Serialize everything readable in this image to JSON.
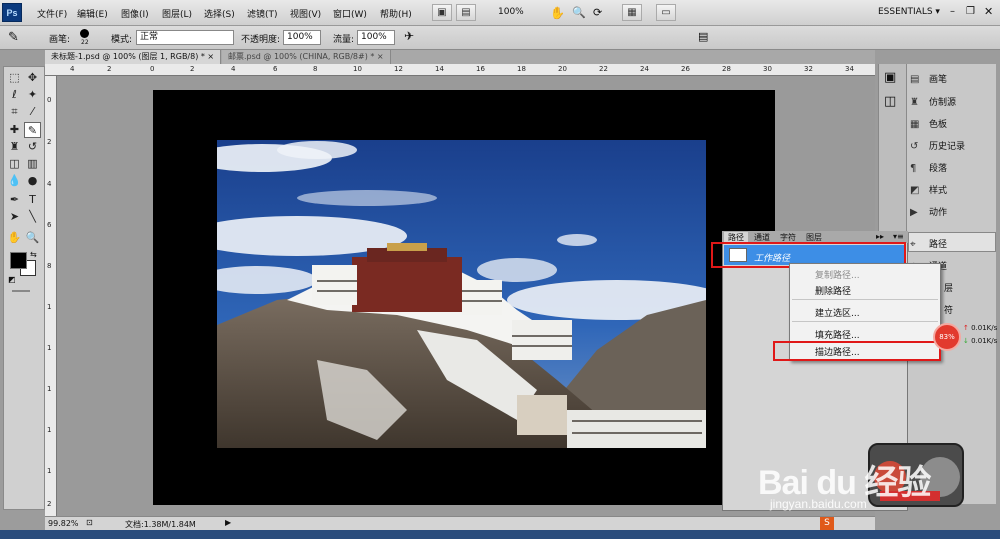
{
  "app": {
    "logo_text": "Ps"
  },
  "menubar": {
    "items": [
      "文件(F)",
      "编辑(E)",
      "图像(I)",
      "图层(L)",
      "选择(S)",
      "滤镜(T)",
      "视图(V)",
      "窗口(W)",
      "帮助(H)"
    ],
    "zoom": "100%",
    "workspace": "ESSENTIALS ▾"
  },
  "options_bar": {
    "brush_label": "画笔:",
    "brush_size": "22",
    "mode_label": "模式:",
    "mode_value": "正常",
    "opacity_label": "不透明度:",
    "opacity_value": "100%",
    "flow_label": "流量:",
    "flow_value": "100%"
  },
  "document_tabs": [
    {
      "label": "未标题-1.psd @ 100% (图层 1, RGB/8) *  ×",
      "active": true
    },
    {
      "label": "邮票.psd @ 100% (CHINA, RGB/8#) *  ×",
      "active": false
    }
  ],
  "ruler_top_ticks": [
    "4",
    "2",
    "0",
    "2",
    "4",
    "6",
    "8",
    "10",
    "12",
    "14",
    "16",
    "18",
    "20",
    "22",
    "24",
    "26",
    "28",
    "30",
    "32",
    "34"
  ],
  "ruler_left_ticks": [
    "0",
    "2",
    "4",
    "6",
    "8",
    "1",
    "1",
    "1",
    "1",
    "1",
    "2",
    "2"
  ],
  "status": {
    "zoom": "99.82%",
    "doc_info": "文档:1.38M/1.84M"
  },
  "right_panels": {
    "items": [
      {
        "icon": "brush-icon",
        "label": "画笔"
      },
      {
        "icon": "clone-source-icon",
        "label": "仿制源"
      },
      {
        "icon": "swatches-icon",
        "label": "色板"
      },
      {
        "icon": "history-icon",
        "label": "历史记录"
      },
      {
        "icon": "paragraph-icon",
        "label": "段落"
      },
      {
        "icon": "styles-icon",
        "label": "样式"
      },
      {
        "icon": "actions-icon",
        "label": "动作"
      },
      {
        "icon": "paths-icon",
        "label": "路径"
      },
      {
        "icon": "channels-icon",
        "label": "通道"
      }
    ],
    "partial_labels": [
      "层",
      "符"
    ]
  },
  "paths_panel": {
    "tabs": [
      "路径",
      "通道",
      "字符",
      "图层"
    ],
    "work_path_name": "工作路径"
  },
  "context_menu": {
    "items": [
      {
        "label": "复制路径...",
        "enabled": false
      },
      {
        "label": "删除路径",
        "enabled": true
      },
      {
        "label": "建立选区...",
        "enabled": true
      },
      {
        "label": "填充路径...",
        "enabled": true
      },
      {
        "label": "描边路径...",
        "enabled": true
      }
    ]
  },
  "net_speed": {
    "percent": "83%",
    "up": "0.01K/s",
    "down": "0.01K/s"
  },
  "watermark": {
    "logo": "Bai du 经验",
    "url": "jingyan.baidu.com"
  },
  "colors": {
    "selection_blue": "#3d8ee6",
    "highlight_red": "#e01818",
    "canvas_black": "#000000"
  }
}
